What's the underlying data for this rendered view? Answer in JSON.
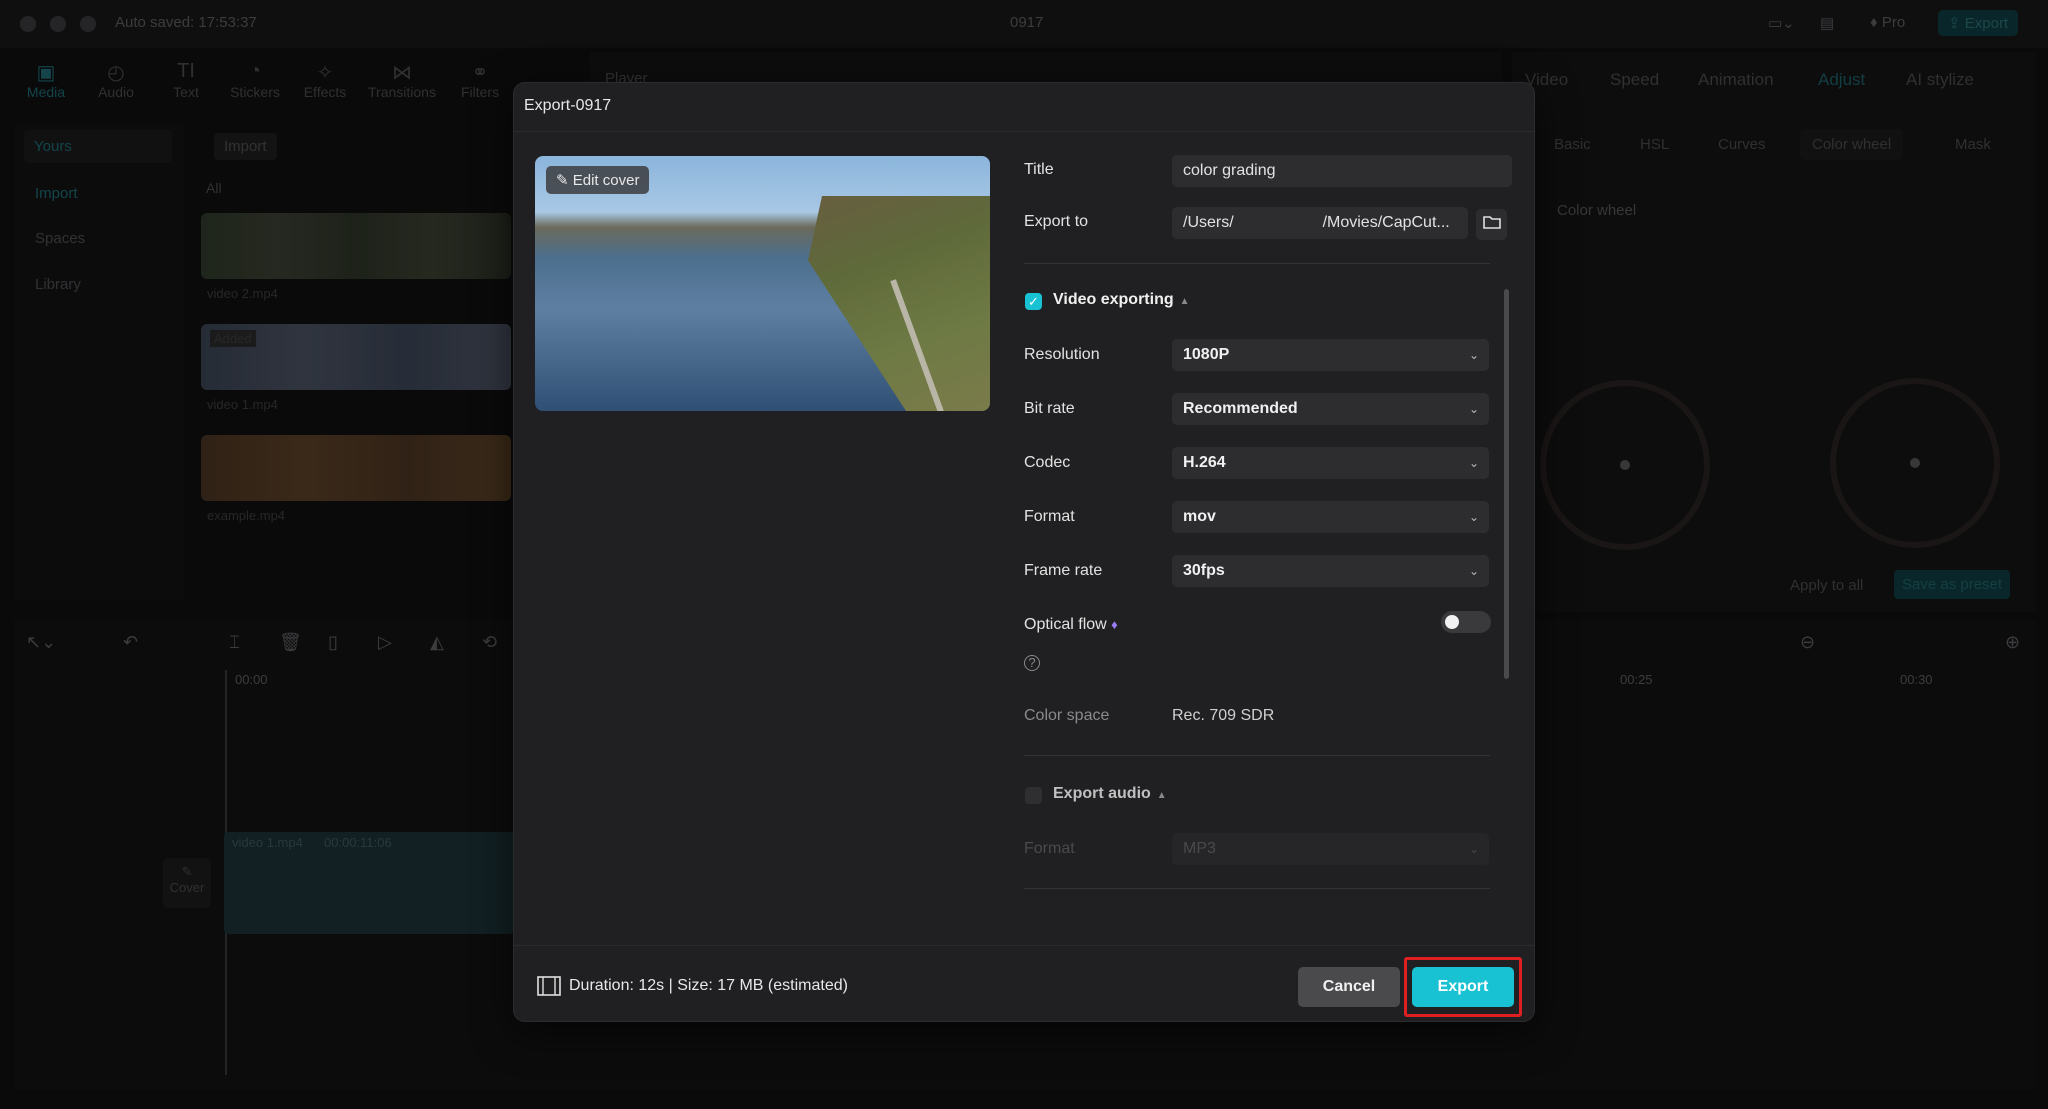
{
  "window": {
    "autosave": "Auto saved: 17:53:37",
    "project_name": "0917",
    "pro_label": "Pro",
    "export_label": "Export"
  },
  "toolbox": [
    {
      "label": "Media",
      "icon": "media-icon"
    },
    {
      "label": "Audio",
      "icon": "audio-icon"
    },
    {
      "label": "Text",
      "icon": "text-icon"
    },
    {
      "label": "Stickers",
      "icon": "stickers-icon"
    },
    {
      "label": "Effects",
      "icon": "effects-icon"
    },
    {
      "label": "Transitions",
      "icon": "transitions-icon"
    },
    {
      "label": "Filters",
      "icon": "filters-icon"
    }
  ],
  "sidebar": {
    "yours": "Yours",
    "import": "Import",
    "spaces": "Spaces",
    "library": "Library"
  },
  "media": {
    "import_button": "Import",
    "filter_all": "All",
    "items": [
      {
        "name": "video 2.mp4",
        "badge": ""
      },
      {
        "name": "video 1.mp4",
        "badge": "Added"
      },
      {
        "name": "example.mp4",
        "badge": ""
      }
    ]
  },
  "player": {
    "title": "Player"
  },
  "right_panel": {
    "tabs": [
      "Video",
      "Speed",
      "Animation",
      "Adjust",
      "AI stylize"
    ],
    "subtabs": [
      "Basic",
      "HSL",
      "Curves",
      "Color wheel",
      "Mask"
    ],
    "section": "Color wheel",
    "apply_all": "Apply to all",
    "save_preset": "Save as preset"
  },
  "timeline": {
    "clip_label": "video 1.mp4",
    "clip_duration": "00:00:11:06",
    "cover_label": "Cover",
    "time_start": "00:00",
    "time_mid": "00:25",
    "time_end": "00:30"
  },
  "dialog": {
    "title": "Export-0917",
    "edit_cover": "Edit cover",
    "title_label": "Title",
    "title_value": "color grading",
    "export_to_label": "Export to",
    "export_to_prefix": "/Users/",
    "export_to_suffix": "/Movies/CapCut...",
    "video_exporting": "Video exporting",
    "resolution_label": "Resolution",
    "resolution_value": "1080P",
    "bitrate_label": "Bit rate",
    "bitrate_value": "Recommended",
    "codec_label": "Codec",
    "codec_value": "H.264",
    "format_label": "Format",
    "format_value": "mov",
    "framerate_label": "Frame rate",
    "framerate_value": "30fps",
    "optical_flow_label": "Optical flow",
    "color_space_label": "Color space",
    "color_space_value": "Rec. 709 SDR",
    "export_audio": "Export audio",
    "audio_format_label": "Format",
    "audio_format_value": "MP3",
    "footer_info": "Duration: 12s | Size: 17 MB (estimated)",
    "cancel": "Cancel",
    "export": "Export"
  },
  "colors": {
    "accent": "#19c2d3",
    "highlight": "#e02020",
    "dialog_bg": "#202022"
  }
}
